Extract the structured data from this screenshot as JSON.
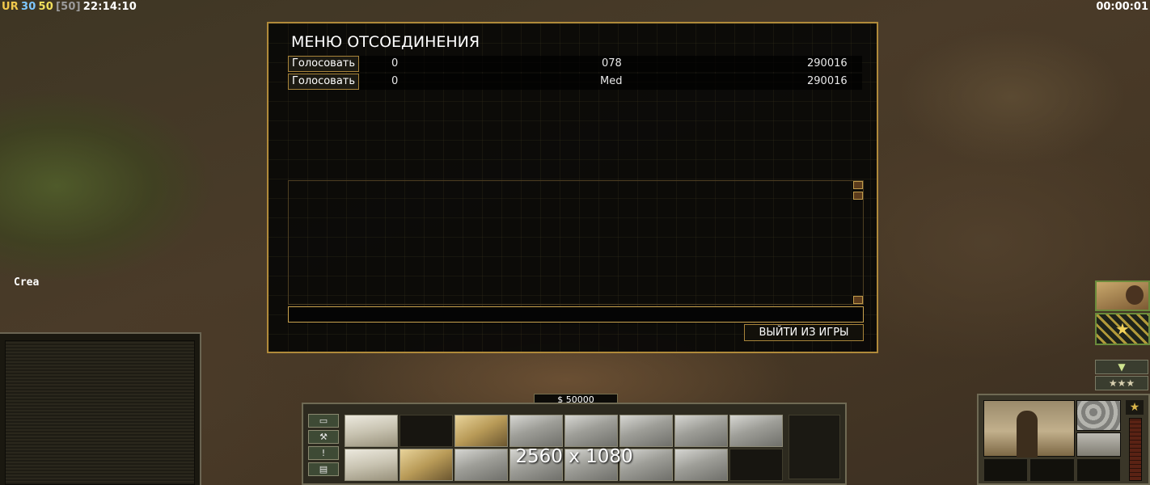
{
  "hud": {
    "stats": [
      {
        "text": "UR",
        "color": "#f2c94c"
      },
      {
        "text": "30",
        "color": "#7ec8ff"
      },
      {
        "text": "50",
        "color": "#f2e05c"
      },
      {
        "text": "[50]",
        "color": "#9b9b9b"
      },
      {
        "text": "22:14:10",
        "color": "#ffffff"
      }
    ],
    "timer": "00:00:01",
    "player_label": "Crea"
  },
  "disconnect_menu": {
    "title": "МЕНЮ ОТСОЕДИНЕНИЯ",
    "rows": [
      {
        "vote_label": "Голосовать",
        "votes": "0",
        "name": "078",
        "ping": "290016"
      },
      {
        "vote_label": "Голосовать",
        "votes": "0",
        "name": "Med",
        "ping": "290016"
      }
    ],
    "quit_label": "ВЫЙТИ ИЗ ИГРЫ"
  },
  "command_bar": {
    "money": "$ 50000",
    "resolution_label": "2560 x 1080",
    "side_buttons": [
      {
        "icon": "options-icon",
        "glyph": "▭"
      },
      {
        "icon": "wrench-icon",
        "glyph": "⚒"
      },
      {
        "icon": "alert-icon",
        "glyph": "!"
      },
      {
        "icon": "diplomacy-icon",
        "glyph": "▤"
      }
    ],
    "build_tiles": [
      {
        "name": "build-tile-barrel",
        "style": "sand"
      },
      {
        "name": "build-tile-empty",
        "style": "dark"
      },
      {
        "name": "build-tile-bunker",
        "style": "tan"
      },
      {
        "name": "build-tile-factory",
        "style": ""
      },
      {
        "name": "build-tile-fan-structure",
        "style": ""
      },
      {
        "name": "build-tile-tower-pad",
        "style": ""
      },
      {
        "name": "build-tile-vehicle-bay",
        "style": ""
      },
      {
        "name": "build-tile-crane",
        "style": ""
      },
      {
        "name": "build-tile-stacked-barrels",
        "style": "sand"
      },
      {
        "name": "build-tile-supply-pile",
        "style": "tan"
      },
      {
        "name": "build-tile-command-center",
        "style": ""
      },
      {
        "name": "build-tile-antenna",
        "style": ""
      },
      {
        "name": "build-tile-oil-derrick",
        "style": ""
      },
      {
        "name": "build-tile-ramp",
        "style": ""
      },
      {
        "name": "build-tile-bunker-2",
        "style": ""
      },
      {
        "name": "build-tile-empty-2",
        "style": "dark"
      }
    ]
  },
  "right_panel": {
    "rank_stars": "★",
    "down_arrow": "▼",
    "star_rating": "★★★",
    "veterancy_icon": "★"
  }
}
